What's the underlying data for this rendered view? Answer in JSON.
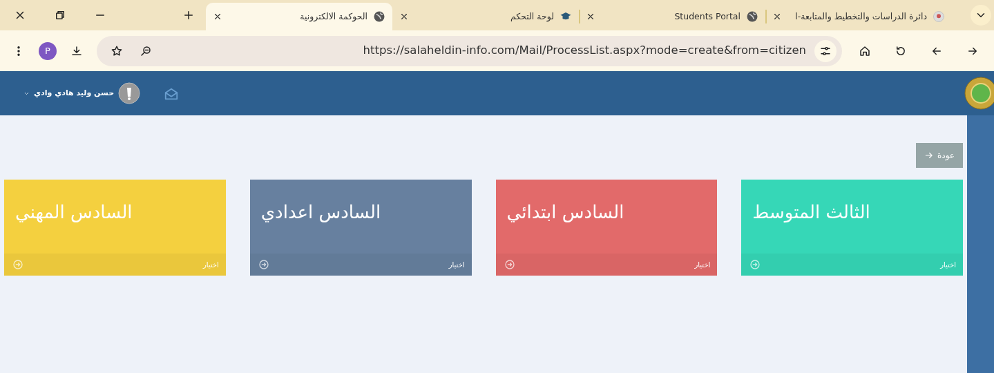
{
  "browser": {
    "tabs": [
      {
        "title": "دائرة الدراسات والتخطيط والمتابعة-ا",
        "kind": "emblem",
        "selected": false
      },
      {
        "title": "Students Portal",
        "kind": "globe",
        "selected": false
      },
      {
        "title": "لوحة التحكم",
        "kind": "cap",
        "selected": false
      },
      {
        "title": "الحوكمة الالكترونية",
        "kind": "globe",
        "selected": true
      }
    ],
    "profile_initial": "P",
    "url": "https://salaheldin-info.com/Mail/ProcessList.aspx?mode=create&from=citizen"
  },
  "header": {
    "user_name": "حسن وليد هادي وادي"
  },
  "back_button": {
    "label": "عودة"
  },
  "cards": [
    {
      "title": "الثالث المتوسط",
      "action": "اختيار",
      "color": "#36d7b7"
    },
    {
      "title": "السادس ابتدائي",
      "action": "اختيار",
      "color": "#e26a6a"
    },
    {
      "title": "السادس اعدادي",
      "action": "اختيار",
      "color": "#67809f"
    },
    {
      "title": "السادس المهني",
      "action": "اختيار",
      "color": "#f4d03f"
    }
  ]
}
